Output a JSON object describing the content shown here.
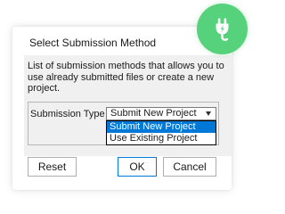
{
  "dialog": {
    "title": "Select Submission Method",
    "description": "List of submission methods that allows you to use already submitted files or create a new project.",
    "submission_type": {
      "label": "Submission Type",
      "selected_value": "Submit New Project",
      "options": [
        "Submit New Project",
        "Use Existing Project"
      ],
      "highlighted_option": "Submit New Project"
    },
    "buttons": {
      "reset": "Reset",
      "ok": "OK",
      "cancel": "Cancel"
    }
  },
  "badge": {
    "icon": "power-plug-icon",
    "color": "#56d17c"
  },
  "colors": {
    "selection": "#0078d7",
    "dialog_background": "#f0f0f0"
  }
}
